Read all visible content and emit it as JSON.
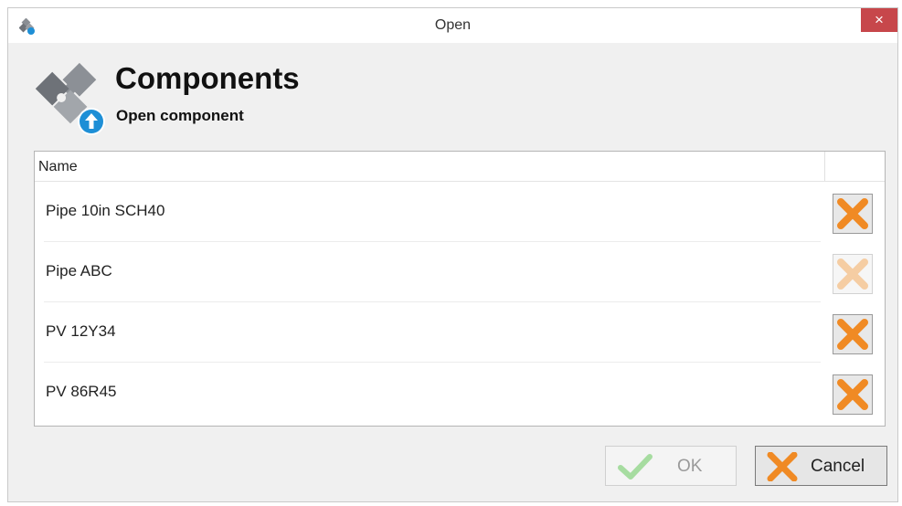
{
  "window": {
    "title": "Open",
    "close_label": "×"
  },
  "header": {
    "title": "Components",
    "subtitle": "Open component"
  },
  "list": {
    "column_name": "Name",
    "rows": [
      {
        "name": "Pipe 10in SCH40",
        "delete_enabled": true
      },
      {
        "name": "Pipe ABC",
        "delete_enabled": false
      },
      {
        "name": "PV 12Y34",
        "delete_enabled": true
      },
      {
        "name": "PV 86R45",
        "delete_enabled": true
      }
    ]
  },
  "buttons": {
    "ok_label": "OK",
    "cancel_label": "Cancel"
  },
  "colors": {
    "delete_orange": "#f08a24",
    "delete_disabled": "#f5cda3",
    "ok_check_disabled": "#a6dca0",
    "close_red": "#c7474b",
    "upload_blue": "#1e8fd6",
    "puzzle_gray": "#7a7e84"
  },
  "icons": {
    "app": "puzzle-icon",
    "header": "puzzle-upload-icon",
    "delete": "x-icon",
    "ok": "checkmark-icon",
    "cancel": "x-icon"
  }
}
